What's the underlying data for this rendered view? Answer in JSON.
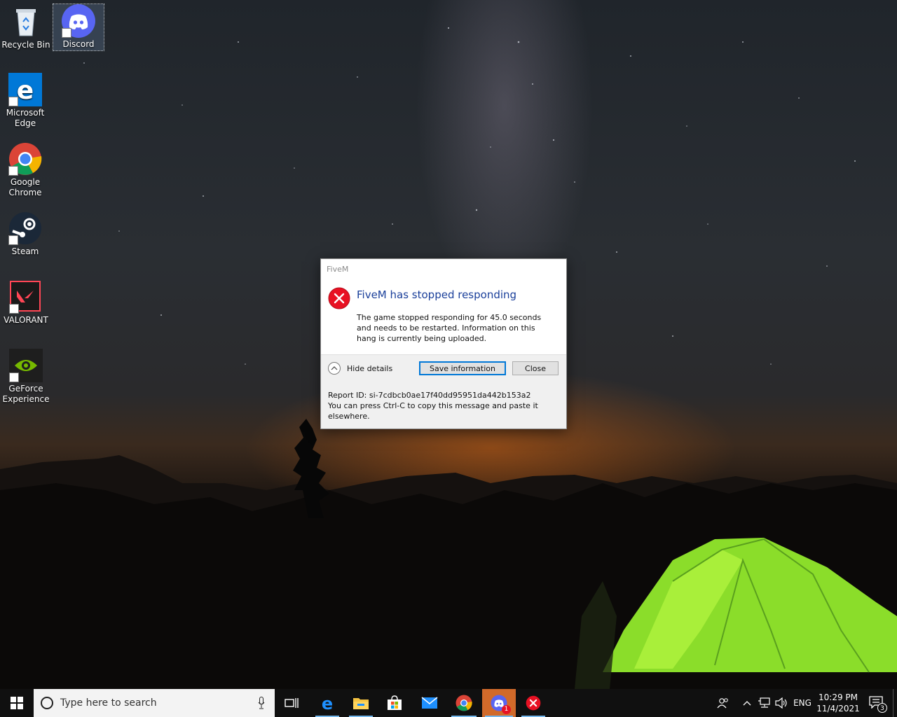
{
  "desktop": {
    "icons": [
      {
        "label": "Recycle Bin"
      },
      {
        "label": "Discord"
      },
      {
        "label": "Microsoft Edge"
      },
      {
        "label": "Google Chrome"
      },
      {
        "label": "Steam"
      },
      {
        "label": "VALORANT"
      },
      {
        "label": "GeForce Experience"
      }
    ]
  },
  "dialog": {
    "window_title": "FiveM",
    "heading": "FiveM has stopped responding",
    "body": "The game stopped responding for 45.0 seconds and needs to be restarted. Information on this hang is currently being uploaded.",
    "toggle_label": "Hide details",
    "save_label": "Save information",
    "close_label": "Close",
    "report_id": "Report ID: si-7cdbcb0ae17f40dd95951da442b153a2",
    "copy_hint": "You can press Ctrl-C to copy this message and paste it elsewhere."
  },
  "taskbar": {
    "search_placeholder": "Type here to search",
    "language": "ENG",
    "time": "10:29 PM",
    "date": "11/4/2021",
    "notification_count": "3",
    "discord_badge": "1"
  },
  "colors": {
    "accent": "#0078d7",
    "error_red": "#e81123",
    "heading_blue": "#1a3f9a",
    "discord": "#5865f2"
  }
}
